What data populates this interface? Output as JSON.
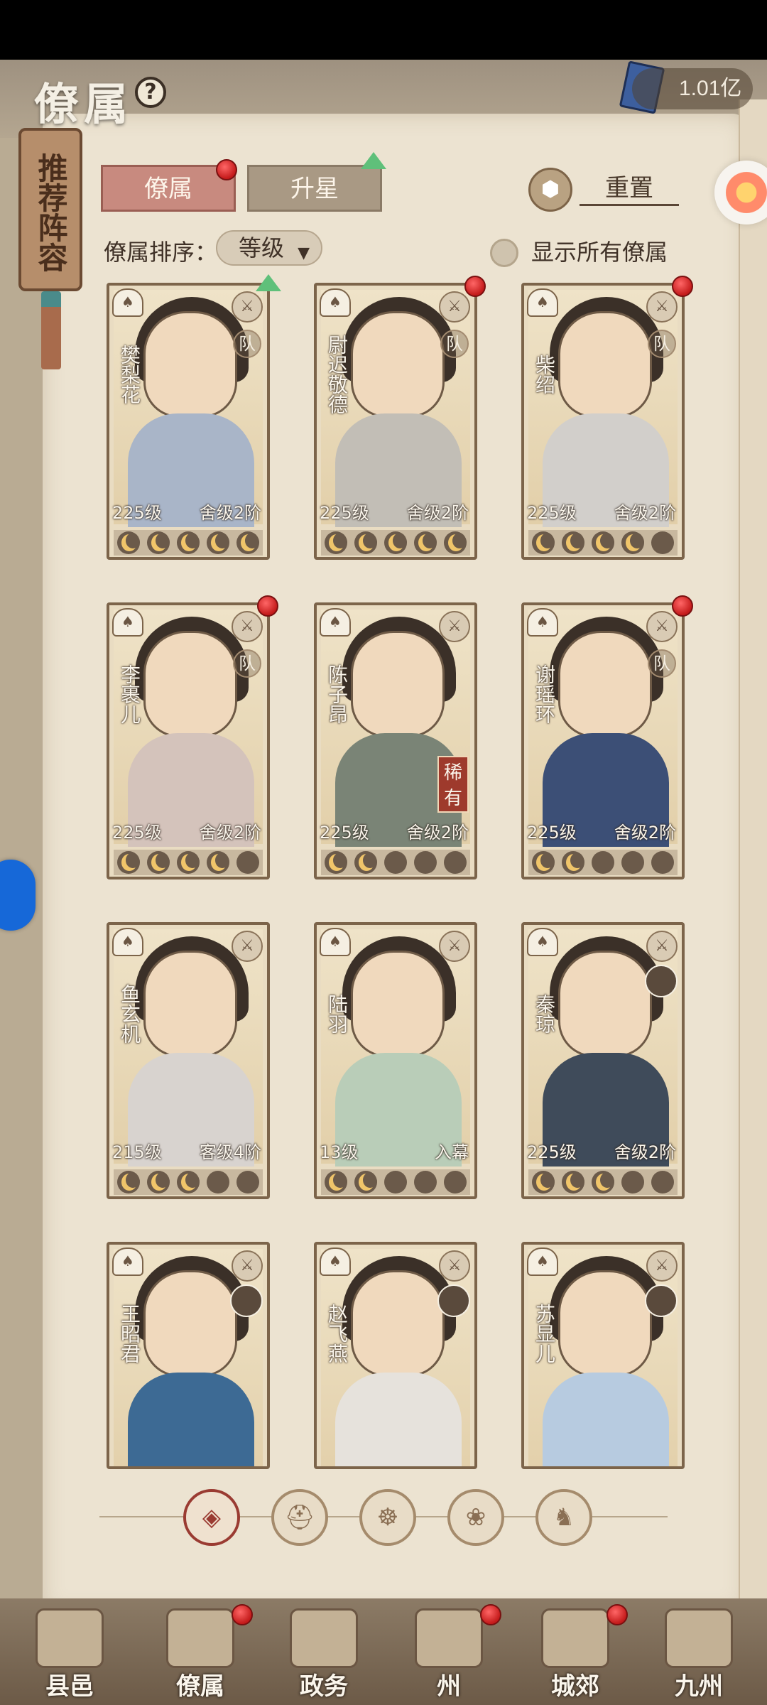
{
  "header": {
    "title": "僚属",
    "help_icon": "?",
    "currency_value": "1.01亿",
    "currency_icon": "book-icon"
  },
  "recommend_panel": {
    "label": "推荐阵容"
  },
  "tabs": [
    {
      "label": "僚属",
      "active": true,
      "has_dot": true
    },
    {
      "label": "升星",
      "active": false,
      "has_arrow": true
    }
  ],
  "reset": {
    "label": "重置",
    "icon": "hexagon-arrows-icon"
  },
  "sort": {
    "label": "僚属排序：",
    "value": "等级"
  },
  "show_all": {
    "label": "显示所有僚属",
    "checked": false
  },
  "cards": [
    {
      "name": "樊梨花",
      "level": "225级",
      "rank": "舍级2阶",
      "stars": 5,
      "dot": false,
      "arrow": true,
      "badge": "队",
      "rare": "",
      "type_icon": "shield-icon",
      "class_icon": "fan-icon"
    },
    {
      "name": "尉迟敬德",
      "level": "225级",
      "rank": "舍级2阶",
      "stars": 5,
      "dot": true,
      "arrow": false,
      "badge": "队",
      "rare": "",
      "type_icon": "sword-icon",
      "class_icon": "helmet-icon"
    },
    {
      "name": "柴绍",
      "level": "225级",
      "rank": "舍级2阶",
      "stars": 4,
      "dot": true,
      "arrow": false,
      "badge": "队",
      "rare": "",
      "type_icon": "sword-icon",
      "class_icon": "lion-icon"
    },
    {
      "name": "李裹儿",
      "level": "225级",
      "rank": "舍级2阶",
      "stars": 4,
      "dot": true,
      "arrow": false,
      "badge": "队",
      "rare": "",
      "type_icon": "yin-yang-icon",
      "class_icon": "cat-icon"
    },
    {
      "name": "陈子昂",
      "level": "225级",
      "rank": "舍级2阶",
      "stars": 2,
      "dot": false,
      "arrow": false,
      "badge": "",
      "rare": "稀有",
      "type_icon": "sword-icon",
      "class_icon": "fan-icon"
    },
    {
      "name": "谢瑶环",
      "level": "225级",
      "rank": "舍级2阶",
      "stars": 2,
      "dot": true,
      "arrow": false,
      "badge": "队",
      "rare": "",
      "type_icon": "sword-icon",
      "class_icon": "helmet-icon"
    },
    {
      "name": "鱼玄机",
      "level": "215级",
      "rank": "客级4阶",
      "stars": 3,
      "dot": false,
      "arrow": false,
      "badge": "",
      "rare": "",
      "type_icon": "hat-icon",
      "class_icon": "fan-icon",
      "avatar": false
    },
    {
      "name": "陆羽",
      "level": "13级",
      "rank": "入幕",
      "stars": 2,
      "dot": false,
      "arrow": false,
      "badge": "",
      "rare": "",
      "type_icon": "hat-icon",
      "class_icon": "helmet-icon",
      "avatar": false
    },
    {
      "name": "秦琼",
      "level": "225级",
      "rank": "舍级2阶",
      "stars": 3,
      "dot": false,
      "arrow": false,
      "badge": "",
      "rare": "",
      "type_icon": "sword-icon",
      "class_icon": "helmet-icon",
      "avatar": true
    },
    {
      "name": "王昭君",
      "level": "225级",
      "rank": "舍级2阶",
      "stars": 0,
      "dot": false,
      "arrow": false,
      "badge": "",
      "rare": "",
      "type_icon": "yin-yang-icon",
      "class_icon": "cat-icon",
      "avatar": true
    },
    {
      "name": "赵飞燕",
      "level": "225级",
      "rank": "舍级2阶",
      "stars": 0,
      "dot": false,
      "arrow": false,
      "badge": "",
      "rare": "",
      "type_icon": "sword-icon",
      "class_icon": "fan-icon",
      "avatar": true
    },
    {
      "name": "苏显儿",
      "level": "225级",
      "rank": "舍级2阶",
      "stars": 0,
      "dot": false,
      "arrow": false,
      "badge": "",
      "rare": "",
      "type_icon": "sword-icon",
      "class_icon": "cat-icon",
      "avatar": true
    }
  ],
  "filters": [
    {
      "icon": "diamond-grid-icon",
      "glyph": "◈",
      "active": true
    },
    {
      "icon": "helmet-icon",
      "glyph": "⛑",
      "active": false
    },
    {
      "icon": "cat-icon",
      "glyph": "☸",
      "active": false
    },
    {
      "icon": "fan-icon",
      "glyph": "❀",
      "active": false
    },
    {
      "icon": "lion-icon",
      "glyph": "♞",
      "active": false
    }
  ],
  "bottom_nav": [
    {
      "label": "县邑",
      "dot": false
    },
    {
      "label": "僚属",
      "dot": true
    },
    {
      "label": "政务",
      "dot": false
    },
    {
      "label": "州",
      "dot": true
    },
    {
      "label": "城郊",
      "dot": true
    },
    {
      "label": "九州",
      "dot": false
    }
  ]
}
